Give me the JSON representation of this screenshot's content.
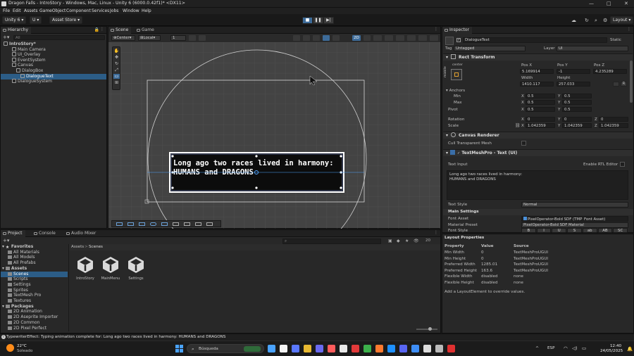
{
  "window": {
    "title": "Dragon Falls - IntroStory - Windows, Mac, Linux - Unity 6 (6000.0.42f1)* <DX11>",
    "controls": [
      "—",
      "□",
      "✕"
    ]
  },
  "menu": [
    "File",
    "Edit",
    "Assets",
    "GameObject",
    "Component",
    "Services",
    "Jobs",
    "Window",
    "Help"
  ],
  "toolbar": {
    "account": "Unity 6",
    "u_button": "U",
    "asset_store": "Asset Store",
    "layout": "Layout"
  },
  "hierarchy": {
    "tab": "Hierarchy",
    "search_placeholder": "All",
    "items": [
      {
        "label": "IntroStory*",
        "indent": 0
      },
      {
        "label": "Main Camera",
        "indent": 2
      },
      {
        "label": "UI_Overlay",
        "indent": 2
      },
      {
        "label": "EventSystem",
        "indent": 2
      },
      {
        "label": "Canvas",
        "indent": 2
      },
      {
        "label": "DialogBox",
        "indent": 3
      },
      {
        "label": "DialogueText",
        "indent": 4
      },
      {
        "label": "DialogueSystem",
        "indent": 2
      }
    ],
    "selected_index": 6
  },
  "scene": {
    "tabs": [
      "Scene",
      "Game"
    ],
    "pivot_mode": "Center",
    "space_mode": "Local",
    "snap_value": "1",
    "mode_2d": "2D",
    "dialogue_line1": "Long ago two races lived in harmony:",
    "dialogue_line2": "HUMANS and DRAGONS",
    "accent": "#4fa3ff"
  },
  "inspector": {
    "tab": "Inspector",
    "object_name": "DialogueText",
    "static_label": "Static",
    "tag_label": "Tag",
    "tag_value": "Untagged",
    "layer_label": "Layer",
    "layer_value": "UI",
    "rect_transform": {
      "header": "Rect Transform",
      "anchor_preset_top": "center",
      "anchor_preset_side": "middle",
      "pos_x_label": "Pos X",
      "pos_x": "5.169914",
      "pos_y_label": "Pos Y",
      "pos_y": "-1",
      "pos_z_label": "Pos Z",
      "pos_z": "4.235289",
      "width_label": "Width",
      "width": "1410.117",
      "height_label": "Height",
      "height": "257.033",
      "rb_label": "R",
      "anchors_label": "Anchors",
      "min_label": "Min",
      "min_x": "0.5",
      "min_y": "0.5",
      "max_label": "Max",
      "max_x": "0.5",
      "max_y": "0.5",
      "pivot_label": "Pivot",
      "pivot_x": "0.5",
      "pivot_y": "0.5",
      "rotation_label": "Rotation",
      "rot_x": "0",
      "rot_y": "0",
      "rot_z": "0",
      "scale_label": "Scale",
      "scale_x": "1.042359",
      "scale_y": "1.042359",
      "scale_z": "1.042359",
      "x_label": "X",
      "y_label": "Y",
      "z_label": "Z"
    },
    "canvas_renderer": {
      "header": "Canvas Renderer",
      "cull_label": "Cull Transparent Mesh"
    },
    "tmp": {
      "header": "TextMeshPro - Text (UI)",
      "text_input_label": "Text Input",
      "enable_rtl": "Enable RTL Editor",
      "text_value_line1": "Long ago two races lived in harmony:",
      "text_value_line2": "HUMANS and DRAGONS",
      "text_style_label": "Text Style",
      "text_style_value": "Normal",
      "main_settings": "Main Settings",
      "font_asset_label": "Font Asset",
      "font_asset_value": "PixelOperator-Bold SDF (TMP_Font Asset)",
      "material_preset_label": "Material Preset",
      "material_preset_value": "PixelOperator-Bold SDF Material",
      "font_style_label": "Font Style",
      "font_style_buttons": [
        "B",
        "I",
        "U",
        "S",
        "ab",
        "AB",
        "SC"
      ]
    }
  },
  "layout_properties": {
    "header": "Layout Properties",
    "columns": [
      "Property",
      "Value",
      "Source"
    ],
    "rows": [
      [
        "Min Width",
        "0",
        "TextMeshProUGUI"
      ],
      [
        "Min Height",
        "0",
        "TextMeshProUGUI"
      ],
      [
        "Preferred Width",
        "1285.01",
        "TextMeshProUGUI"
      ],
      [
        "Preferred Height",
        "163.6",
        "TextMeshProUGUI"
      ],
      [
        "Flexible Width",
        "disabled",
        "none"
      ],
      [
        "Flexible Height",
        "disabled",
        "none"
      ]
    ],
    "footer": "Add a LayoutElement to override values."
  },
  "project": {
    "tabs": [
      "Project",
      "Console",
      "Audio Mixer"
    ],
    "breadcrumb": [
      "Assets",
      "Scenes"
    ],
    "count": "20",
    "tree": [
      {
        "label": "Favorites",
        "indent": 0,
        "bold": true
      },
      {
        "label": "All Materials",
        "indent": 1
      },
      {
        "label": "All Models",
        "indent": 1
      },
      {
        "label": "All Prefabs",
        "indent": 1
      },
      {
        "label": "Assets",
        "indent": 0,
        "bold": true
      },
      {
        "label": "Scenes",
        "indent": 1,
        "selected": true
      },
      {
        "label": "Scripts",
        "indent": 1
      },
      {
        "label": "Settings",
        "indent": 1
      },
      {
        "label": "Sprites",
        "indent": 1
      },
      {
        "label": "TextMesh Pro",
        "indent": 1
      },
      {
        "label": "Textures",
        "indent": 1
      },
      {
        "label": "Packages",
        "indent": 0,
        "bold": true
      },
      {
        "label": "2D Animation",
        "indent": 1
      },
      {
        "label": "2D Aseprite Importer",
        "indent": 1
      },
      {
        "label": "2D Common",
        "indent": 1
      },
      {
        "label": "2D Pixel Perfect",
        "indent": 1
      }
    ],
    "assets": [
      "IntroStory",
      "MainMenu",
      "Settings"
    ]
  },
  "status": {
    "message": "TypewriterEffect: Typing animation complete for: Long ago two races lived in harmony:  HUMANS and DRAGONS"
  },
  "taskbar": {
    "weather_temp": "22°C",
    "weather_desc": "Soleado",
    "search_placeholder": "Búsqueda",
    "lang": "ESP",
    "time": "12:40",
    "date": "24/05/2025",
    "app_colors": [
      "#4aa3ff",
      "#f5f5f5",
      "#5a78ff",
      "#e8b931",
      "#6a6af0",
      "#ff5c5c",
      "#e8e8e8",
      "#e23a3a",
      "#3cb04b",
      "#ff7a2f",
      "#1e90ff",
      "#5865f2",
      "#3e8ef7",
      "#ddd",
      "#bbb",
      "#e03030"
    ]
  }
}
